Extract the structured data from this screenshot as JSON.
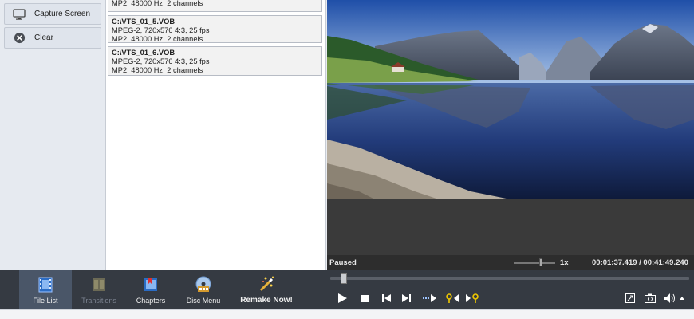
{
  "sidebar": {
    "capture_label": "Capture Screen",
    "clear_label": "Clear"
  },
  "files": [
    {
      "partial": true,
      "line3": "MP2, 48000 Hz, 2 channels"
    },
    {
      "name": "C:\\VTS_01_5.VOB",
      "line2": "MPEG-2, 720x576 4:3, 25 fps",
      "line3": "MP2, 48000 Hz, 2 channels"
    },
    {
      "name": "C:\\VTS_01_6.VOB",
      "line2": "MPEG-2, 720x576 4:3, 25 fps",
      "line3": "MP2, 48000 Hz, 2 channels"
    }
  ],
  "player": {
    "state": "Paused",
    "speed": "1x",
    "time": "00:01:37.419 / 00:41:49.240",
    "seek_fraction": 0.03
  },
  "tabs": [
    {
      "label": "File List",
      "active": true,
      "disabled": false
    },
    {
      "label": "Transitions",
      "active": false,
      "disabled": true
    },
    {
      "label": "Chapters",
      "active": false,
      "disabled": false
    },
    {
      "label": "Disc Menu",
      "active": false,
      "disabled": false
    },
    {
      "label": "Remake Now!",
      "active": false,
      "disabled": false
    }
  ],
  "colors": {
    "toolbar_bg": "#353a42",
    "active_tab": "#4a5668",
    "chapter_marker": "#f0c800"
  }
}
